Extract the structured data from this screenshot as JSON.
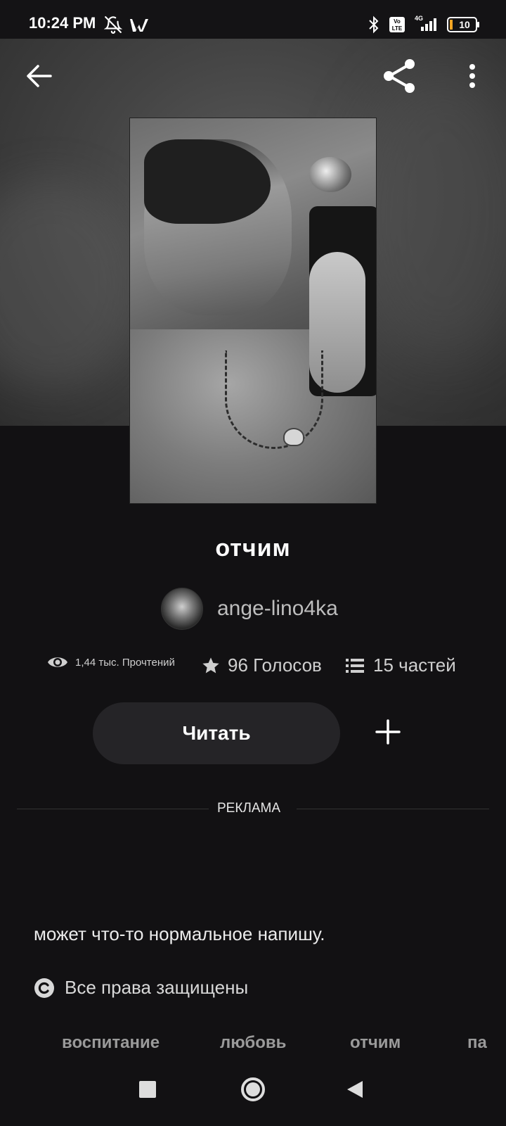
{
  "status_bar": {
    "time": "10:24 PM",
    "icons": [
      "bell-off-icon",
      "wattpad-w-icon",
      "bluetooth-icon",
      "volte-icon",
      "signal-4g-icon",
      "battery-icon"
    ],
    "volte_label": "Vo\nLTE",
    "network_label": "4G",
    "battery_level": "10"
  },
  "header": {
    "back_icon": "arrow-left-icon",
    "share_icon": "share-icon",
    "menu_icon": "more-vertical-icon"
  },
  "story": {
    "title": "отчим",
    "author": "ange-lino4ka",
    "reads_label": "1,44 тыс. Прочтений",
    "votes_label": "96 Голосов",
    "parts_label": "15 частей",
    "read_button": "Читать",
    "add_icon": "plus-icon"
  },
  "ad": {
    "label": "РЕКЛАМА"
  },
  "description": "может что-то нормальное напишу.",
  "rights": {
    "icon": "copyright-icon",
    "label": "Все права защищены"
  },
  "tags": [
    "воспитание",
    "любовь",
    "отчим",
    "па"
  ],
  "nav_bar": {
    "buttons": [
      "recents-square-icon",
      "home-circle-icon",
      "back-triangle-icon"
    ]
  },
  "colors": {
    "background": "#121113",
    "button_bg": "#252427",
    "text_muted": "#bdbdbd",
    "tag_text": "#9a9a9a"
  }
}
